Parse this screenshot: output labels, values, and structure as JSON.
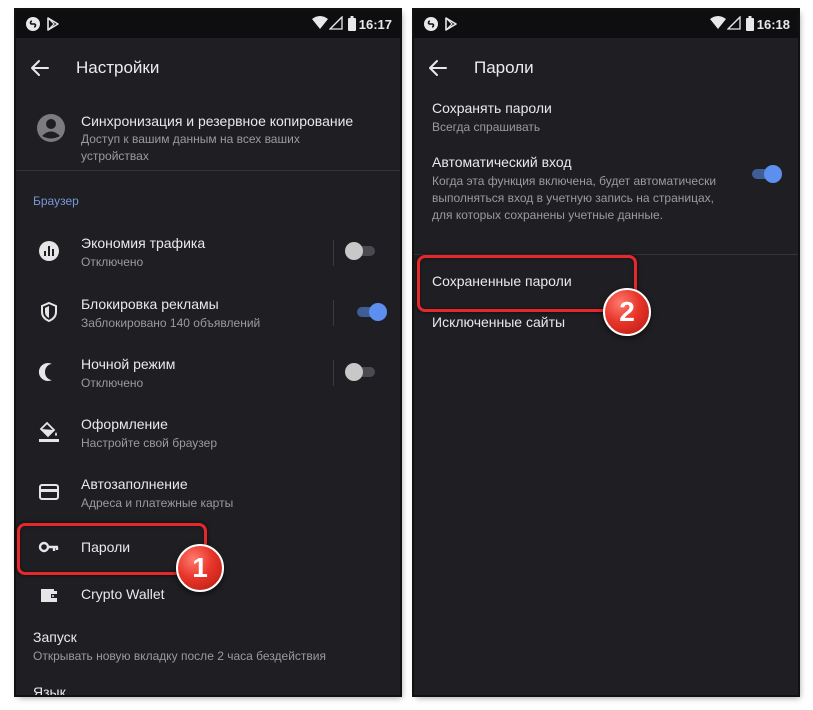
{
  "left": {
    "status": {
      "time": "16:17"
    },
    "title": "Настройки",
    "account": {
      "title": "Синхронизация и резервное копирование",
      "subtitle": "Доступ к вашим данным на всех ваших устройствах"
    },
    "section_label": "Браузер",
    "items": [
      {
        "label": "Экономия трафика",
        "sub": "Отключено",
        "icon": "traffic-chart-icon",
        "toggle": "off"
      },
      {
        "label": "Блокировка рекламы",
        "sub": "Заблокировано 140 объявлений",
        "icon": "shield-icon",
        "toggle": "on"
      },
      {
        "label": "Ночной режим",
        "sub": "Отключено",
        "icon": "moon-icon",
        "toggle": "off"
      },
      {
        "label": "Оформление",
        "sub": "Настройте свой браузер",
        "icon": "paint-bucket-icon"
      },
      {
        "label": "Автозаполнение",
        "sub": "Адреса и платежные карты",
        "icon": "credit-card-icon"
      },
      {
        "label": "Пароли",
        "icon": "key-icon"
      },
      {
        "label": "Crypto Wallet",
        "icon": "wallet-icon"
      }
    ],
    "startup": {
      "title": "Запуск",
      "subtitle": "Открывать новую вкладку после 2 часа бездействия"
    },
    "language": {
      "title": "Язык"
    },
    "badge": "1"
  },
  "right": {
    "status": {
      "time": "16:18"
    },
    "title": "Пароли",
    "save_passwords": {
      "title": "Сохранять пароли",
      "subtitle": "Всегда спрашивать"
    },
    "auto_login": {
      "title": "Автоматический вход",
      "subtitle": "Когда эта функция включена, будет автоматически выполняться вход в учетную запись на страницах, для которых сохранены учетные данные.",
      "toggle": "on"
    },
    "saved_passwords": "Сохраненные пароли",
    "excluded_sites": "Исключенные сайты",
    "badge": "2"
  },
  "colors": {
    "background": "#1f1f23",
    "section_accent": "#7b96d6",
    "toggle_on": "#5d8ff0",
    "highlight": "#e6282c"
  }
}
